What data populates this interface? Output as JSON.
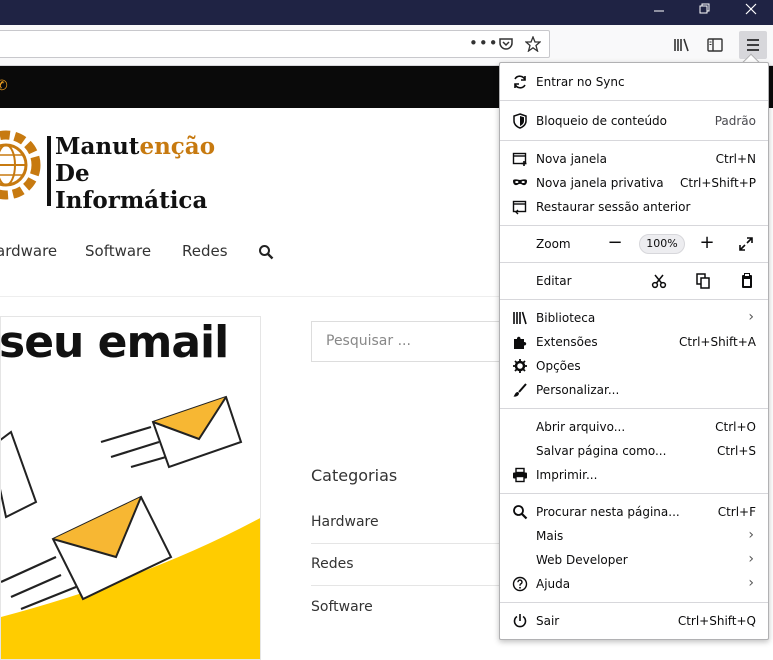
{
  "browser": {
    "url_actions_label": "•••",
    "menu": {
      "sync": "Entrar no Sync",
      "content_blocking": "Bloqueio de conteúdo",
      "content_blocking_value": "Padrão",
      "new_window": "Nova janela",
      "new_window_sc": "Ctrl+N",
      "private_window": "Nova janela privativa",
      "private_window_sc": "Ctrl+Shift+P",
      "restore_session": "Restaurar sessão anterior",
      "zoom": "Zoom",
      "zoom_minus": "−",
      "zoom_value": "100%",
      "zoom_plus": "+",
      "edit": "Editar",
      "library": "Biblioteca",
      "addons": "Extensões",
      "addons_sc": "Ctrl+Shift+A",
      "options": "Opções",
      "customize": "Personalizar...",
      "open_file": "Abrir arquivo...",
      "open_file_sc": "Ctrl+O",
      "save_page": "Salvar página como...",
      "save_page_sc": "Ctrl+S",
      "print": "Imprimir...",
      "find": "Procurar nesta página...",
      "find_sc": "Ctrl+F",
      "more": "Mais",
      "web_developer": "Web Developer",
      "help": "Ajuda",
      "quit": "Sair",
      "quit_sc": "Ctrl+Shift+Q"
    }
  },
  "site": {
    "logo": {
      "line1_a": "Manut",
      "line1_b": "enção",
      "line2": "De",
      "line3": "Informática"
    },
    "nav": [
      "ardware",
      "Software",
      "Redes"
    ],
    "banner_title": "seu email",
    "search_placeholder": "Pesquisar ...",
    "categories_title": "Categorias",
    "categories": [
      "Hardware",
      "Redes",
      "Software"
    ]
  },
  "colors": {
    "titlebar": "#1f2344",
    "accent_orange": "#c77a10",
    "banner_yellow": "#ffcc00"
  }
}
